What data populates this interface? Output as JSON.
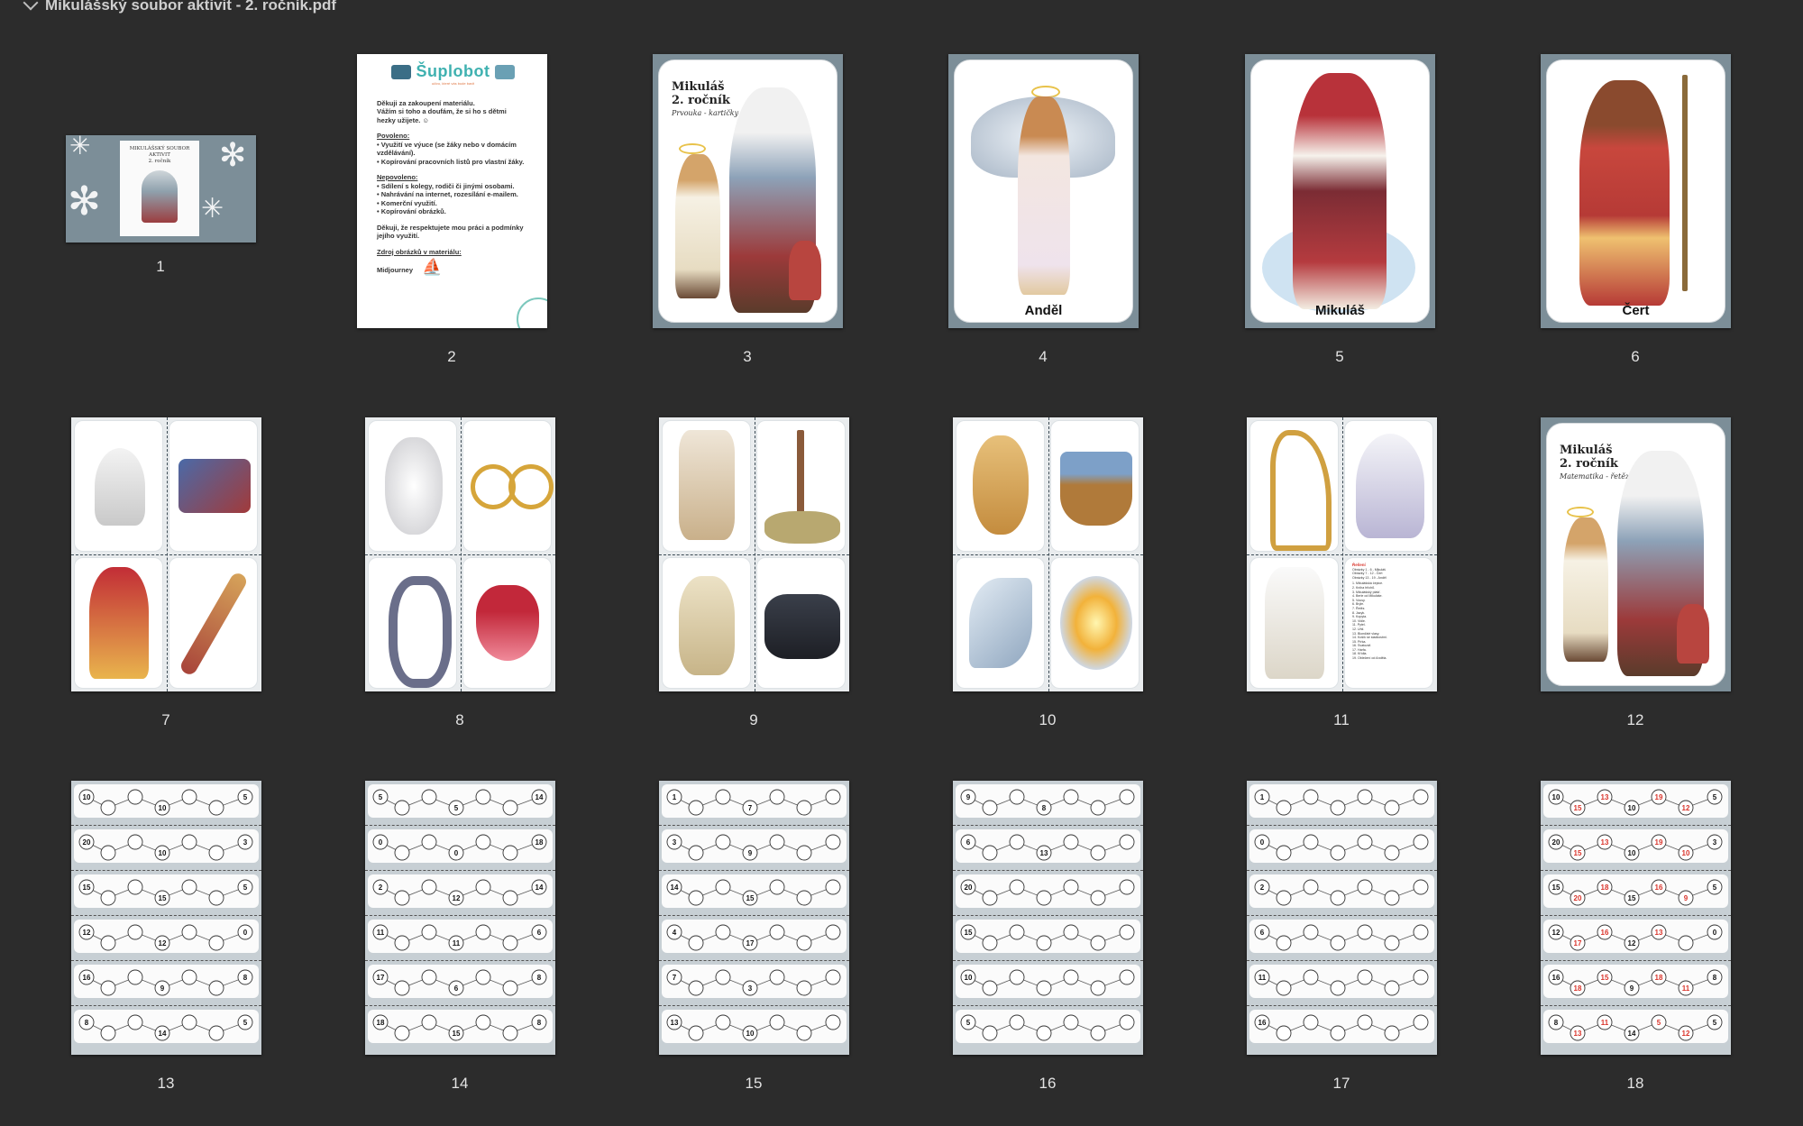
{
  "window": {
    "title": "Mikulášský soubor aktivit - 2. ročník.pdf"
  },
  "icons": {
    "collapse": "chevron-down-icon"
  },
  "thumbnails": [
    {
      "number": "1",
      "title_lines": [
        "MIKULÁŠSKÝ SOUBOR",
        "AKTIVIT",
        "2. ročník"
      ]
    },
    {
      "number": "2",
      "logo": "Šuplobot",
      "logo_tagline": "učivo, které vás bude bavit",
      "lines": [
        "Děkuji za zakoupení materiálu.",
        "Vážím si toho a doufám, že si ho s dětmi",
        "hezky užijete. ☺",
        "Povoleno:",
        "• Využití ve výuce (se žáky nebo v domácím",
        "  vzdělávání).",
        "• Kopírování  pracovních listů pro vlastní žáky.",
        "Nepovoleno:",
        "• Sdílení s kolegy, rodiči či jinými osobami.",
        "• Nahrávání na internet, rozesílání e-mailem.",
        "• Komerční využití.",
        "• Kopírování obrázků.",
        "Děkuji, že respektujete mou práci a podmínky",
        "jejího využití.",
        "Zdroj obrázků v materiálu:",
        "Midjourney"
      ]
    },
    {
      "number": "3",
      "title_lines": [
        "Mikuláš",
        "2. ročník"
      ],
      "subtitle": "Prvouka - kartičky"
    },
    {
      "number": "4",
      "card_label": "Anděl"
    },
    {
      "number": "5",
      "card_label": "Mikuláš"
    },
    {
      "number": "6",
      "card_label": "Čert"
    },
    {
      "number": "7"
    },
    {
      "number": "8"
    },
    {
      "number": "9"
    },
    {
      "number": "10"
    },
    {
      "number": "11",
      "key_title": "Řešení",
      "key_lines": [
        "Obrázky 1 - 6 - Mikuláš",
        "Obrázky 7 - 12 - Čert",
        "Obrázky 13 - 19 - Anděl",
        "1. Mikulášská čepice.",
        "2. Kniha hříchů.",
        "3. Mikulášský plášť.",
        "4. Berle od Mikuláše.",
        "5. Vousy.",
        "6. Brýle.",
        "7. Řetěz.",
        "8. Jazyk.",
        "9. Kopyta.",
        "10. Vidle.",
        "11. Pytel.",
        "12. Uhlí.",
        "13. Blonďaté vlasy.",
        "14. Košík se sladkostmi.",
        "15. Pírka.",
        "16. Svatozář.",
        "17. Harfa.",
        "18. Křídla.",
        "19. Oblečení od Anděla."
      ]
    },
    {
      "number": "12",
      "title_lines": [
        "Mikuláš",
        "2. ročník"
      ],
      "subtitle": "Matematika - řetězy"
    },
    {
      "number": "13",
      "chains": [
        [
          "10",
          "10",
          "5"
        ],
        [
          "20",
          "10",
          "3"
        ],
        [
          "15",
          "15",
          "5"
        ],
        [
          "12",
          "12",
          "0"
        ],
        [
          "16",
          "9",
          "8"
        ],
        [
          "8",
          "14",
          "5"
        ]
      ]
    },
    {
      "number": "14",
      "chains": [
        [
          "5",
          "5",
          "14"
        ],
        [
          "0",
          "0",
          "18"
        ],
        [
          "2",
          "12",
          "14"
        ],
        [
          "11",
          "11",
          "6"
        ],
        [
          "17",
          "6",
          "8"
        ],
        [
          "18",
          "15",
          "8"
        ]
      ]
    },
    {
      "number": "15",
      "chains": [
        [
          "1",
          "7",
          ""
        ],
        [
          "3",
          "9",
          ""
        ],
        [
          "14",
          "15",
          ""
        ],
        [
          "4",
          "17",
          ""
        ],
        [
          "7",
          "3",
          ""
        ],
        [
          "13",
          "10",
          ""
        ]
      ]
    },
    {
      "number": "16",
      "chains": [
        [
          "9",
          "8",
          ""
        ],
        [
          "6",
          "13",
          ""
        ],
        [
          "20",
          "",
          ""
        ],
        [
          "15",
          "",
          ""
        ],
        [
          "10",
          "",
          ""
        ],
        [
          "5",
          "",
          ""
        ]
      ]
    },
    {
      "number": "17",
      "chains": [
        [
          "1",
          "",
          ""
        ],
        [
          "0",
          "",
          ""
        ],
        [
          "2",
          "",
          ""
        ],
        [
          "6",
          "",
          ""
        ],
        [
          "11",
          "",
          ""
        ],
        [
          "16",
          "",
          ""
        ]
      ]
    },
    {
      "number": "18",
      "chains": [
        [
          "10",
          "10",
          "5"
        ],
        [
          "20",
          "10",
          "3"
        ],
        [
          "15",
          "15",
          "5"
        ],
        [
          "12",
          "12",
          "0"
        ],
        [
          "16",
          "9",
          "8"
        ],
        [
          "8",
          "14",
          "5"
        ]
      ],
      "answers": [
        [
          "15",
          "13",
          "19",
          "12"
        ],
        [
          "15",
          "13",
          "19",
          "10"
        ],
        [
          "20",
          "18",
          "16",
          "9"
        ],
        [
          "17",
          "16",
          "13",
          ""
        ],
        [
          "18",
          "15",
          "18",
          "11"
        ],
        [
          "13",
          "11",
          "5",
          "12"
        ]
      ]
    }
  ],
  "colors": {
    "background": "#2c2c2c",
    "page_frame": "#7c8e98",
    "answer_red": "#d9342b",
    "logo_teal": "#3fb1b0"
  }
}
